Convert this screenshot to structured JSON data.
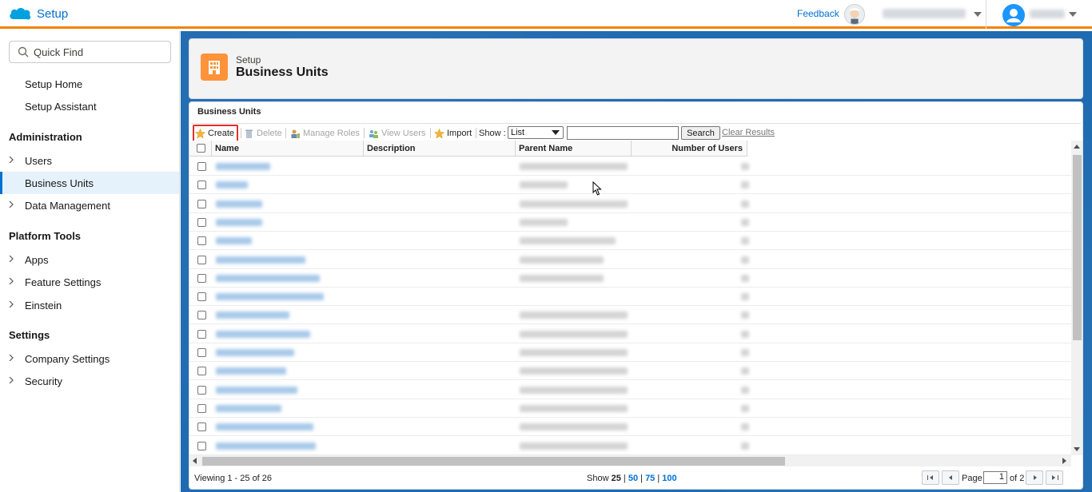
{
  "header": {
    "app_name": "Setup",
    "feedback": "Feedback"
  },
  "sidebar": {
    "quick_find_placeholder": "Quick Find",
    "items": [
      {
        "label": "Setup Home"
      },
      {
        "label": "Setup Assistant"
      }
    ],
    "sections": [
      {
        "title": "Administration",
        "items": [
          {
            "label": "Users"
          },
          {
            "label": "Business Units",
            "active": true
          },
          {
            "label": "Data Management"
          }
        ]
      },
      {
        "title": "Platform Tools",
        "items": [
          {
            "label": "Apps"
          },
          {
            "label": "Feature Settings"
          },
          {
            "label": "Einstein"
          }
        ]
      },
      {
        "title": "Settings",
        "items": [
          {
            "label": "Company Settings"
          },
          {
            "label": "Security"
          }
        ]
      }
    ]
  },
  "page": {
    "pre_title": "Setup",
    "title": "Business Units",
    "accent_color": "#fe9339"
  },
  "panel": {
    "title": "Business Units",
    "toolbar": {
      "create": "Create",
      "delete": "Delete",
      "manage_roles": "Manage Roles",
      "view_users": "View Users",
      "import": "Import",
      "show_label": "Show :",
      "show_value": "List",
      "search_button": "Search",
      "clear_results": "Clear Results"
    },
    "columns": [
      "Name",
      "Description",
      "Parent Name",
      "Number of Users"
    ],
    "rows_visible": 16,
    "footer": {
      "viewing": "Viewing 1 - 25 of 26",
      "show_label": "Show",
      "show_current": "25",
      "show_options": [
        "50",
        "75",
        "100"
      ],
      "page_label": "Page",
      "page_value": "1",
      "of_label": "of 2"
    }
  },
  "colors": {
    "header_stripe": "#f38303",
    "link": "#0070d2",
    "main_bg": "#1f6bb1",
    "highlight_box": "#e0312c"
  }
}
